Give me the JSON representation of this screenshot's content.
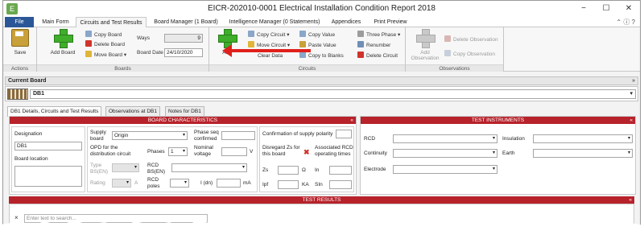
{
  "window": {
    "title": "EICR-202010-0001 Electrical Installation Condition Report 2018",
    "app_icon": "E",
    "controls": {
      "minimize": "−",
      "maximize": "☐",
      "close": "✕"
    }
  },
  "tabs": [
    {
      "label": "File"
    },
    {
      "label": "Main Form"
    },
    {
      "label": "Circuits and Test Results"
    },
    {
      "label": "Board Manager (1 Board)"
    },
    {
      "label": "Intelligence Manager (0 Statements)"
    },
    {
      "label": "Appendices"
    },
    {
      "label": "Print Preview"
    }
  ],
  "help_icons": "⌃ ⓘ ?",
  "ribbon": {
    "actions": {
      "title": "Actions",
      "save": "Save"
    },
    "boards": {
      "title": "Boards",
      "add_board": "Add Board",
      "copy_board": "Copy Board",
      "delete_board": "Delete Board",
      "move_board": "Move Board ▾",
      "ways_label": "Ways",
      "ways_value": "9",
      "board_date_label": "Board Date",
      "board_date_value": "24/10/2020"
    },
    "circuits": {
      "title": "Circuits",
      "add_circuit": "Add",
      "copy_circuit": "Copy Circuit ▾",
      "move_circuit": "Move Circuit ▾",
      "clear_data": "Clear Data",
      "copy_value": "Copy Value",
      "paste_value": "Paste Value",
      "copy_to_blanks": "Copy to Blanks",
      "three_phase": "Three Phase ▾",
      "renumber": "Renumber",
      "delete_circuit": "Delete Circuit"
    },
    "observations": {
      "title": "Observations",
      "add_observation": "Add Observation",
      "delete_observation": "Delete Observation",
      "copy_observation": "Copy Observation"
    }
  },
  "current_board": {
    "header": "Current Board",
    "value": "DB1"
  },
  "subtabs": [
    {
      "label": "DB1 Details, Circuits and Test Results"
    },
    {
      "label": "Observations at DB1"
    },
    {
      "label": "Notes for DB1"
    }
  ],
  "board_characteristics": {
    "header": "BOARD CHARACTERISTICS",
    "designation_label": "Designation",
    "designation_value": "DB1",
    "board_location_label": "Board location",
    "supply_board_label": "Supply board",
    "supply_board_value": "Origin",
    "phase_seq_label": "Phase seq confirmed",
    "opd_label": "OPD for the distribution circuit",
    "phases_label": "Phases",
    "phases_value": "1",
    "nominal_voltage_label": "Nominal voltage",
    "volt_unit": "V",
    "type_label": "Type BS(EN)",
    "rcd_bsen_label": "RCD BS(EN)",
    "rating_label": "Rating",
    "amp_unit": "A",
    "rcd_poles_label": "RCD poles",
    "idn_label": "I (dn)",
    "ma_unit": "mA",
    "confirmation_label": "Confirmation of supply polarity",
    "disregard_label": "Disregard Zs for this board",
    "associated_rcd_label": "Associated RCD operating times",
    "zs_label": "Zs",
    "ohm_unit": "Ω",
    "in_label": "In",
    "ipf_label": "Ipf",
    "ka_unit": "KA",
    "sin_label": "SIn"
  },
  "test_instruments": {
    "header": "TEST INSTRUMENTS",
    "rcd_label": "RCD",
    "continuity_label": "Continuity",
    "electrode_label": "Electrode",
    "insulation_label": "Insulation",
    "earth_label": "Earth"
  },
  "test_results": {
    "header": "TEST RESULTS",
    "search_placeholder": "Enter text to search..."
  },
  "colors": {
    "accent_red": "#b7222b",
    "file_tab": "#2b5797",
    "arrow": "#e0201c"
  }
}
